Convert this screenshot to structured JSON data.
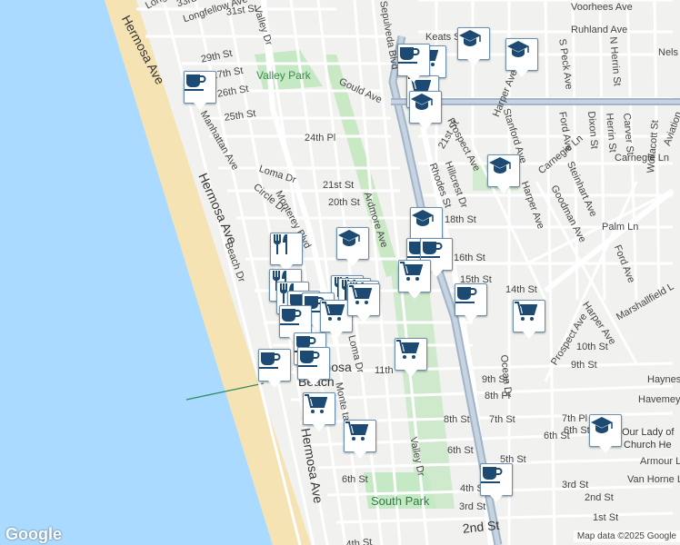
{
  "map": {
    "google_logo": "Google",
    "attribution": "Map data ©2025 Google",
    "labels": [
      {
        "id": "longfellow",
        "text": "Longfellow Ave"
      },
      {
        "id": "longfellow2",
        "text": "Longfellow Ave"
      },
      {
        "id": "s33rd",
        "text": "33rd St"
      },
      {
        "id": "s31st",
        "text": "31st St"
      },
      {
        "id": "voorhees",
        "text": "Voorhees Ave"
      },
      {
        "id": "keats",
        "text": "Keats St"
      },
      {
        "id": "ruhland",
        "text": "Ruhland Ave"
      },
      {
        "id": "nels",
        "text": "Nels"
      },
      {
        "id": "s29th",
        "text": "29th St"
      },
      {
        "id": "s27th",
        "text": "27th St"
      },
      {
        "id": "s26th",
        "text": "26th St"
      },
      {
        "id": "s25th",
        "text": "25th St"
      },
      {
        "id": "valleypark",
        "text": "Valley Park"
      },
      {
        "id": "gould",
        "text": "Gould Ave"
      },
      {
        "id": "p24th",
        "text": "24th Pl"
      },
      {
        "id": "hermosa_top",
        "text": "Hermosa Ave"
      },
      {
        "id": "manhattan",
        "text": "Manhattan Ave"
      },
      {
        "id": "hermosa_mid",
        "text": "Hermosa Ave"
      },
      {
        "id": "beachdr",
        "text": "Beach Dr"
      },
      {
        "id": "lomadr",
        "text": "Loma Dr"
      },
      {
        "id": "circledr",
        "text": "Circle Dr"
      },
      {
        "id": "monterey",
        "text": "Monterey Blvd"
      },
      {
        "id": "s21st",
        "text": "21st St"
      },
      {
        "id": "s20th",
        "text": "20th St"
      },
      {
        "id": "ardmore",
        "text": "Ardmore Ave"
      },
      {
        "id": "valleydr_top",
        "text": "Valley Dr"
      },
      {
        "id": "sepulveda",
        "text": "Sepulveda Blvd"
      },
      {
        "id": "prospect",
        "text": "Prospect Ave"
      },
      {
        "id": "s21st_e",
        "text": "21st St"
      },
      {
        "id": "hillcrest",
        "text": "Hillcrest Dr"
      },
      {
        "id": "rhodes",
        "text": "Rhodes St"
      },
      {
        "id": "s18th",
        "text": "18th St"
      },
      {
        "id": "s16th",
        "text": "16th St"
      },
      {
        "id": "s15th",
        "text": "15th St"
      },
      {
        "id": "s14th",
        "text": "14th St"
      },
      {
        "id": "harper1",
        "text": "Harper Ave"
      },
      {
        "id": "stanford",
        "text": "Stanford Ave"
      },
      {
        "id": "fordave",
        "text": "Ford Ave"
      },
      {
        "id": "dixon",
        "text": "Dixon St"
      },
      {
        "id": "herrin",
        "text": "Herrin St"
      },
      {
        "id": "carver",
        "text": "Carver St"
      },
      {
        "id": "speck",
        "text": "S Peck Ave"
      },
      {
        "id": "nherrin",
        "text": "N Herrin St"
      },
      {
        "id": "carnegie1",
        "text": "Carnegie Ln"
      },
      {
        "id": "carnegie2",
        "text": "Carnegie Ln"
      },
      {
        "id": "harper2",
        "text": "Harper Ave"
      },
      {
        "id": "steinhart",
        "text": "Steinhart Ave"
      },
      {
        "id": "goodman",
        "text": "Goodman Ave"
      },
      {
        "id": "palm",
        "text": "Palm Ln"
      },
      {
        "id": "wollacott",
        "text": "Wollacott St"
      },
      {
        "id": "aviation",
        "text": "Aviation"
      },
      {
        "id": "fordave2",
        "text": "Ford Ave"
      },
      {
        "id": "marshallfield",
        "text": "Marshallfield L"
      },
      {
        "id": "harper3",
        "text": "Harper Ave"
      },
      {
        "id": "prospect2",
        "text": "Prospect Ave"
      },
      {
        "id": "s10th",
        "text": "10th St"
      },
      {
        "id": "s9th_e",
        "text": "9th St"
      },
      {
        "id": "haynes",
        "text": "Haynes"
      },
      {
        "id": "lomadr2",
        "text": "Loma Dr"
      },
      {
        "id": "s11th",
        "text": "11th"
      },
      {
        "id": "s9th",
        "text": "9th St"
      },
      {
        "id": "p8th",
        "text": "8th Pl"
      },
      {
        "id": "oceandr",
        "text": "Ocean Dr"
      },
      {
        "id": "s8th",
        "text": "8th St"
      },
      {
        "id": "s7th",
        "text": "7th St"
      },
      {
        "id": "p7th",
        "text": "7th Pl"
      },
      {
        "id": "havemeyer",
        "text": "Havemeyer"
      },
      {
        "id": "s6th_e",
        "text": "6th St"
      },
      {
        "id": "s6th_e2",
        "text": "6th St"
      },
      {
        "id": "ourlady1",
        "text": "Our Lady of"
      },
      {
        "id": "ourlady2",
        "text": "Church He"
      },
      {
        "id": "armour",
        "text": "Armour L"
      },
      {
        "id": "s6th_m",
        "text": "6th St"
      },
      {
        "id": "s5th",
        "text": "5th St"
      },
      {
        "id": "vanhorne",
        "text": "Van Horne L"
      },
      {
        "id": "s4th",
        "text": "4th St"
      },
      {
        "id": "s3rd",
        "text": "3rd St"
      },
      {
        "id": "s3rd_e",
        "text": "3rd St"
      },
      {
        "id": "s2nd_e",
        "text": "2nd St"
      },
      {
        "id": "s2nd",
        "text": "2nd St"
      },
      {
        "id": "s1st",
        "text": "1st St"
      },
      {
        "id": "valleydr",
        "text": "Valley Dr"
      },
      {
        "id": "southpark",
        "text": "South Park"
      },
      {
        "id": "hermosa_low",
        "text": "Hermosa Ave"
      },
      {
        "id": "montereylow",
        "text": "Monte   tan Ave"
      },
      {
        "id": "s6th_w",
        "text": "6th St"
      },
      {
        "id": "s4th_w",
        "text": "4th St"
      },
      {
        "id": "hermosabeach1",
        "text": "Hermosa"
      },
      {
        "id": "hermosabeach2",
        "text": "Beach"
      }
    ],
    "markers": [
      {
        "type": "coffee"
      },
      {
        "type": "shopping"
      },
      {
        "type": "school"
      },
      {
        "type": "school"
      },
      {
        "type": "shopping"
      },
      {
        "type": "school"
      },
      {
        "type": "school"
      },
      {
        "type": "coffee"
      },
      {
        "type": "school"
      },
      {
        "type": "restaurant"
      },
      {
        "type": "school"
      },
      {
        "type": "coffee"
      },
      {
        "type": "coffee"
      },
      {
        "type": "restaurant"
      },
      {
        "type": "shopping"
      },
      {
        "type": "restaurant"
      },
      {
        "type": "restaurant"
      },
      {
        "type": "restaurant"
      },
      {
        "type": "restaurant"
      },
      {
        "type": "coffee"
      },
      {
        "type": "coffee"
      },
      {
        "type": "shopping"
      },
      {
        "type": "coffee"
      },
      {
        "type": "shopping"
      },
      {
        "type": "coffee"
      },
      {
        "type": "shopping"
      },
      {
        "type": "coffee"
      },
      {
        "type": "coffee"
      },
      {
        "type": "shopping"
      },
      {
        "type": "shopping"
      },
      {
        "type": "school"
      },
      {
        "type": "coffee"
      },
      {
        "type": "coffee"
      },
      {
        "type": "shopping"
      }
    ],
    "colors": {
      "water": "#aadaff",
      "sand": "#f5e3b4",
      "land": "#f1f1ef",
      "highway": "#a2b4c8",
      "park": "#c5e8c5",
      "pin_border": "#6a8fb0",
      "icon": "#1c4a72"
    }
  }
}
